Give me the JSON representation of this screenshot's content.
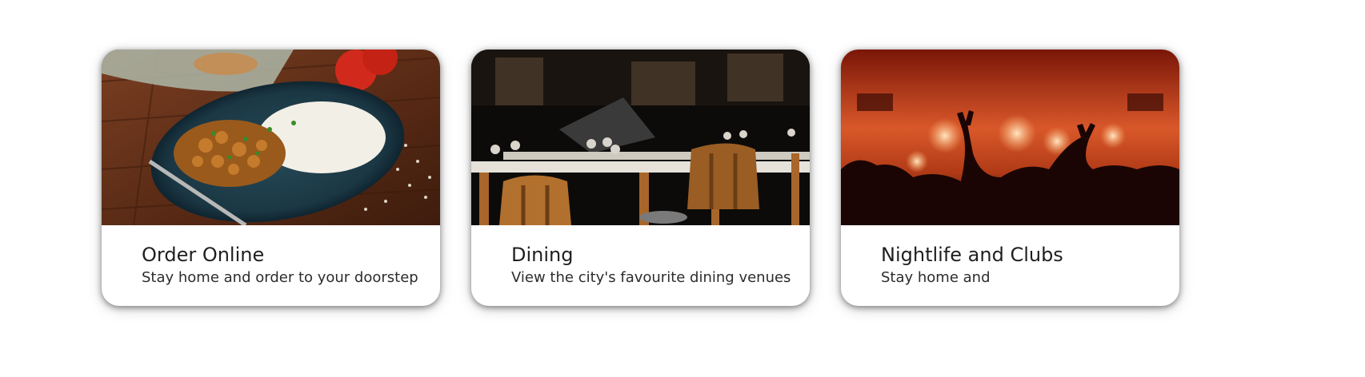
{
  "cards": [
    {
      "title": "Order Online",
      "subtitle": "Stay home and order to your doorstep",
      "image_icon": "food-plate-photo"
    },
    {
      "title": "Dining",
      "subtitle": "View the city's favourite dining venues",
      "image_icon": "restaurant-interior-photo"
    },
    {
      "title": "Nightlife and Clubs",
      "subtitle": "Stay home and",
      "image_icon": "nightclub-crowd-photo"
    }
  ]
}
